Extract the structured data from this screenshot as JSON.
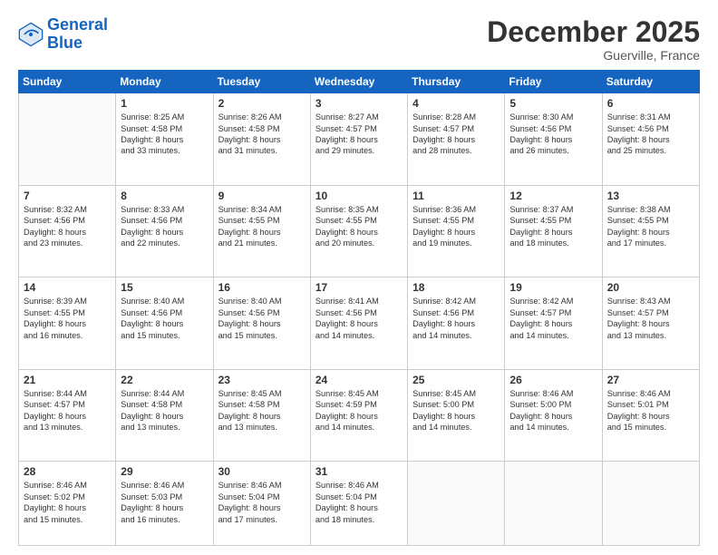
{
  "logo": {
    "line1": "General",
    "line2": "Blue"
  },
  "header": {
    "month": "December 2025",
    "location": "Guerville, France"
  },
  "days_of_week": [
    "Sunday",
    "Monday",
    "Tuesday",
    "Wednesday",
    "Thursday",
    "Friday",
    "Saturday"
  ],
  "weeks": [
    [
      {
        "day": "",
        "empty": true
      },
      {
        "day": "1",
        "sunrise": "Sunrise: 8:25 AM",
        "sunset": "Sunset: 4:58 PM",
        "daylight": "Daylight: 8 hours",
        "daylight2": "and 33 minutes."
      },
      {
        "day": "2",
        "sunrise": "Sunrise: 8:26 AM",
        "sunset": "Sunset: 4:58 PM",
        "daylight": "Daylight: 8 hours",
        "daylight2": "and 31 minutes."
      },
      {
        "day": "3",
        "sunrise": "Sunrise: 8:27 AM",
        "sunset": "Sunset: 4:57 PM",
        "daylight": "Daylight: 8 hours",
        "daylight2": "and 29 minutes."
      },
      {
        "day": "4",
        "sunrise": "Sunrise: 8:28 AM",
        "sunset": "Sunset: 4:57 PM",
        "daylight": "Daylight: 8 hours",
        "daylight2": "and 28 minutes."
      },
      {
        "day": "5",
        "sunrise": "Sunrise: 8:30 AM",
        "sunset": "Sunset: 4:56 PM",
        "daylight": "Daylight: 8 hours",
        "daylight2": "and 26 minutes."
      },
      {
        "day": "6",
        "sunrise": "Sunrise: 8:31 AM",
        "sunset": "Sunset: 4:56 PM",
        "daylight": "Daylight: 8 hours",
        "daylight2": "and 25 minutes."
      }
    ],
    [
      {
        "day": "7",
        "sunrise": "Sunrise: 8:32 AM",
        "sunset": "Sunset: 4:56 PM",
        "daylight": "Daylight: 8 hours",
        "daylight2": "and 23 minutes."
      },
      {
        "day": "8",
        "sunrise": "Sunrise: 8:33 AM",
        "sunset": "Sunset: 4:56 PM",
        "daylight": "Daylight: 8 hours",
        "daylight2": "and 22 minutes."
      },
      {
        "day": "9",
        "sunrise": "Sunrise: 8:34 AM",
        "sunset": "Sunset: 4:55 PM",
        "daylight": "Daylight: 8 hours",
        "daylight2": "and 21 minutes."
      },
      {
        "day": "10",
        "sunrise": "Sunrise: 8:35 AM",
        "sunset": "Sunset: 4:55 PM",
        "daylight": "Daylight: 8 hours",
        "daylight2": "and 20 minutes."
      },
      {
        "day": "11",
        "sunrise": "Sunrise: 8:36 AM",
        "sunset": "Sunset: 4:55 PM",
        "daylight": "Daylight: 8 hours",
        "daylight2": "and 19 minutes."
      },
      {
        "day": "12",
        "sunrise": "Sunrise: 8:37 AM",
        "sunset": "Sunset: 4:55 PM",
        "daylight": "Daylight: 8 hours",
        "daylight2": "and 18 minutes."
      },
      {
        "day": "13",
        "sunrise": "Sunrise: 8:38 AM",
        "sunset": "Sunset: 4:55 PM",
        "daylight": "Daylight: 8 hours",
        "daylight2": "and 17 minutes."
      }
    ],
    [
      {
        "day": "14",
        "sunrise": "Sunrise: 8:39 AM",
        "sunset": "Sunset: 4:55 PM",
        "daylight": "Daylight: 8 hours",
        "daylight2": "and 16 minutes."
      },
      {
        "day": "15",
        "sunrise": "Sunrise: 8:40 AM",
        "sunset": "Sunset: 4:56 PM",
        "daylight": "Daylight: 8 hours",
        "daylight2": "and 15 minutes."
      },
      {
        "day": "16",
        "sunrise": "Sunrise: 8:40 AM",
        "sunset": "Sunset: 4:56 PM",
        "daylight": "Daylight: 8 hours",
        "daylight2": "and 15 minutes."
      },
      {
        "day": "17",
        "sunrise": "Sunrise: 8:41 AM",
        "sunset": "Sunset: 4:56 PM",
        "daylight": "Daylight: 8 hours",
        "daylight2": "and 14 minutes."
      },
      {
        "day": "18",
        "sunrise": "Sunrise: 8:42 AM",
        "sunset": "Sunset: 4:56 PM",
        "daylight": "Daylight: 8 hours",
        "daylight2": "and 14 minutes."
      },
      {
        "day": "19",
        "sunrise": "Sunrise: 8:42 AM",
        "sunset": "Sunset: 4:57 PM",
        "daylight": "Daylight: 8 hours",
        "daylight2": "and 14 minutes."
      },
      {
        "day": "20",
        "sunrise": "Sunrise: 8:43 AM",
        "sunset": "Sunset: 4:57 PM",
        "daylight": "Daylight: 8 hours",
        "daylight2": "and 13 minutes."
      }
    ],
    [
      {
        "day": "21",
        "sunrise": "Sunrise: 8:44 AM",
        "sunset": "Sunset: 4:57 PM",
        "daylight": "Daylight: 8 hours",
        "daylight2": "and 13 minutes."
      },
      {
        "day": "22",
        "sunrise": "Sunrise: 8:44 AM",
        "sunset": "Sunset: 4:58 PM",
        "daylight": "Daylight: 8 hours",
        "daylight2": "and 13 minutes."
      },
      {
        "day": "23",
        "sunrise": "Sunrise: 8:45 AM",
        "sunset": "Sunset: 4:58 PM",
        "daylight": "Daylight: 8 hours",
        "daylight2": "and 13 minutes."
      },
      {
        "day": "24",
        "sunrise": "Sunrise: 8:45 AM",
        "sunset": "Sunset: 4:59 PM",
        "daylight": "Daylight: 8 hours",
        "daylight2": "and 14 minutes."
      },
      {
        "day": "25",
        "sunrise": "Sunrise: 8:45 AM",
        "sunset": "Sunset: 5:00 PM",
        "daylight": "Daylight: 8 hours",
        "daylight2": "and 14 minutes."
      },
      {
        "day": "26",
        "sunrise": "Sunrise: 8:46 AM",
        "sunset": "Sunset: 5:00 PM",
        "daylight": "Daylight: 8 hours",
        "daylight2": "and 14 minutes."
      },
      {
        "day": "27",
        "sunrise": "Sunrise: 8:46 AM",
        "sunset": "Sunset: 5:01 PM",
        "daylight": "Daylight: 8 hours",
        "daylight2": "and 15 minutes."
      }
    ],
    [
      {
        "day": "28",
        "sunrise": "Sunrise: 8:46 AM",
        "sunset": "Sunset: 5:02 PM",
        "daylight": "Daylight: 8 hours",
        "daylight2": "and 15 minutes."
      },
      {
        "day": "29",
        "sunrise": "Sunrise: 8:46 AM",
        "sunset": "Sunset: 5:03 PM",
        "daylight": "Daylight: 8 hours",
        "daylight2": "and 16 minutes."
      },
      {
        "day": "30",
        "sunrise": "Sunrise: 8:46 AM",
        "sunset": "Sunset: 5:04 PM",
        "daylight": "Daylight: 8 hours",
        "daylight2": "and 17 minutes."
      },
      {
        "day": "31",
        "sunrise": "Sunrise: 8:46 AM",
        "sunset": "Sunset: 5:04 PM",
        "daylight": "Daylight: 8 hours",
        "daylight2": "and 18 minutes."
      },
      {
        "day": "",
        "empty": true
      },
      {
        "day": "",
        "empty": true
      },
      {
        "day": "",
        "empty": true
      }
    ]
  ]
}
